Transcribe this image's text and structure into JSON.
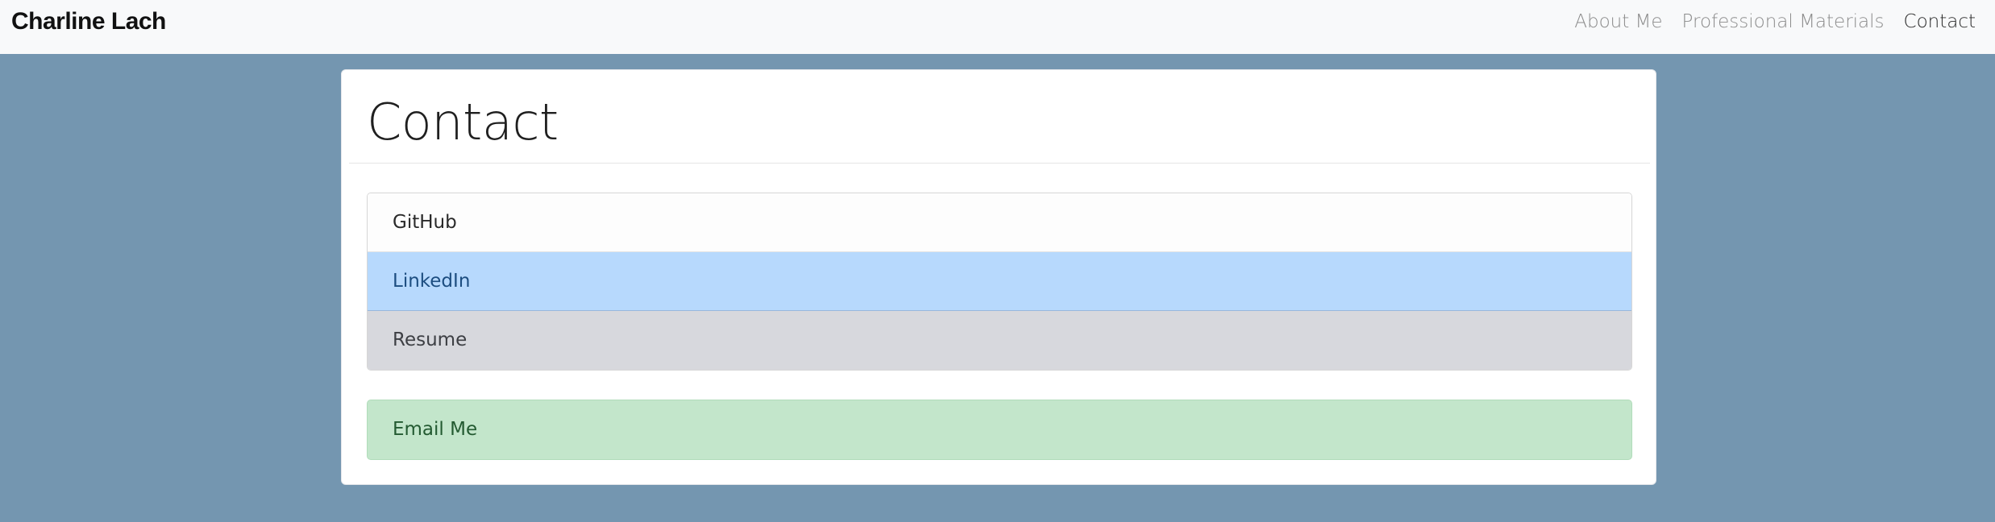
{
  "navbar": {
    "brand": "Charline Lach",
    "links": [
      {
        "label": "About Me",
        "active": false
      },
      {
        "label": "Professional Materials",
        "active": false
      },
      {
        "label": "Contact",
        "active": true
      }
    ]
  },
  "main": {
    "title": "Contact",
    "links": [
      {
        "label": "GitHub",
        "style": "light"
      },
      {
        "label": "LinkedIn",
        "style": "primary"
      },
      {
        "label": "Resume",
        "style": "secondary"
      }
    ],
    "email_label": "Email Me"
  },
  "colors": {
    "page_background": "#7496b0",
    "navbar_background": "#f8f9fa",
    "linkedin_background": "#b7d9fd",
    "resume_background": "#d7d8dd",
    "email_background": "#c3e6cb"
  }
}
